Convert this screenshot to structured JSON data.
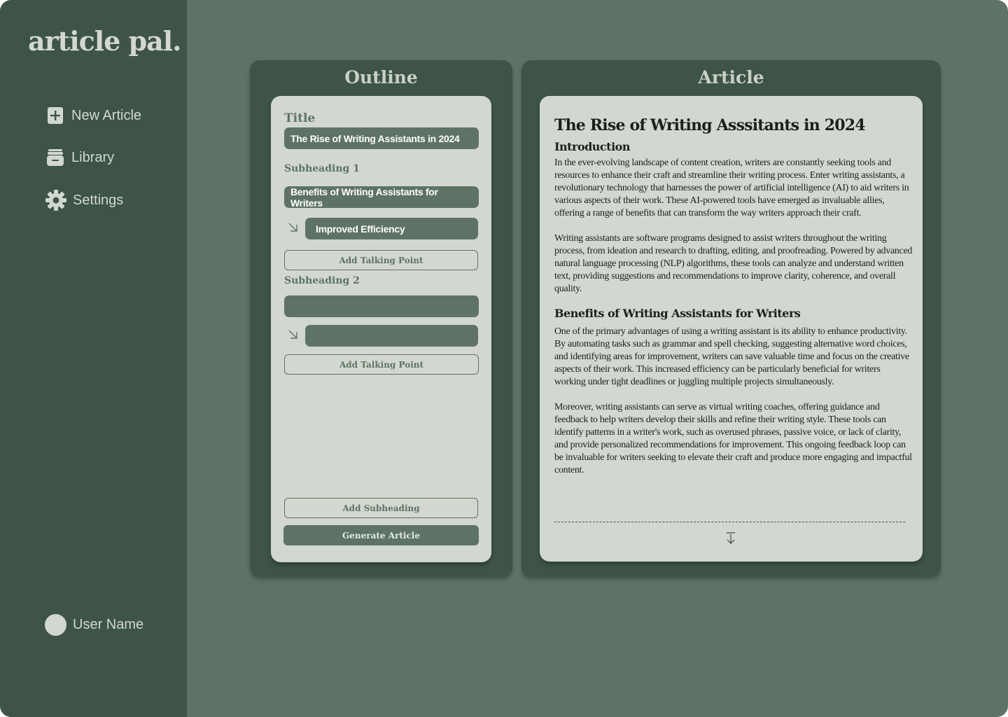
{
  "app": {
    "logo": "article pal."
  },
  "sidebar": {
    "items": [
      {
        "label": "New Article",
        "icon": "plus-square-icon"
      },
      {
        "label": "Library",
        "icon": "archive-box-icon"
      },
      {
        "label": "Settings",
        "icon": "gear-icon"
      }
    ],
    "user": {
      "name": "User Name",
      "icon": "avatar-circle"
    }
  },
  "outline": {
    "heading": "Outline",
    "title_label": "Title",
    "title_value": "The Rise of Writing Assistants in 2024",
    "subheading1_label": "Subheading 1",
    "subheading1_value": "Benefits of Writing Assistants for Writers",
    "talking_point1": "Improved Efficiency",
    "add_talking_point_1": "Add Talking Point",
    "subheading2_label": "Subheading 2",
    "subheading2_value": "",
    "talking_point2": "",
    "add_talking_point_2": "Add Talking Point",
    "add_subheading": "Add Subheading",
    "generate": "Generate Article"
  },
  "article": {
    "heading": "Article",
    "title": "The Rise of Writing Asssitants in 2024",
    "sections": [
      {
        "heading": "Introduction",
        "paragraphs": [
          "In the ever-evolving landscape of content creation, writers are constantly seeking tools and resources to enhance their craft and streamline their writing process. Enter writing assistants, a revolutionary technology that harnesses the power of artificial intelligence (AI) to aid writers in various aspects of their work. These AI-powered tools have emerged as invaluable allies, offering a range of benefits that can transform the way writers approach their craft.",
          "Writing assistants are software programs designed to assist writers throughout the writing process, from ideation and research to drafting, editing, and proofreading. Powered by advanced natural language processing (NLP) algorithms, these tools can analyze and understand written text, providing suggestions and recommendations to improve clarity, coherence, and overall quality."
        ]
      },
      {
        "heading": "Benefits of Writing Assistants for Writers",
        "paragraphs": [
          "One of the primary advantages of using a writing assistant is its ability to enhance productivity. By automating tasks such as grammar and spell checking, suggesting alternative word choices, and identifying areas for improvement, writers can save valuable time and focus on the creative aspects of their work. This increased efficiency can be particularly beneficial for writers working under tight deadlines or juggling multiple projects simultaneously.",
          "Moreover, writing assistants can serve as virtual writing coaches, offering guidance and feedback to help writers develop their skills and refine their writing style. These tools can identify patterns in a writer's work, such as overused phrases, passive voice, or lack of clarity, and provide personalized recommendations for improvement. This ongoing feedback loop can be invaluable for writers seeking to elevate their craft and produce more engaging and impactful content."
        ]
      }
    ],
    "download_icon": "arrow-down-to-line-icon"
  },
  "colors": {
    "background": "#5e7365",
    "sidebar": "#3d5446",
    "card": "#d2d8cf",
    "pill": "#5e7365",
    "text_light": "#d2d8cf"
  }
}
